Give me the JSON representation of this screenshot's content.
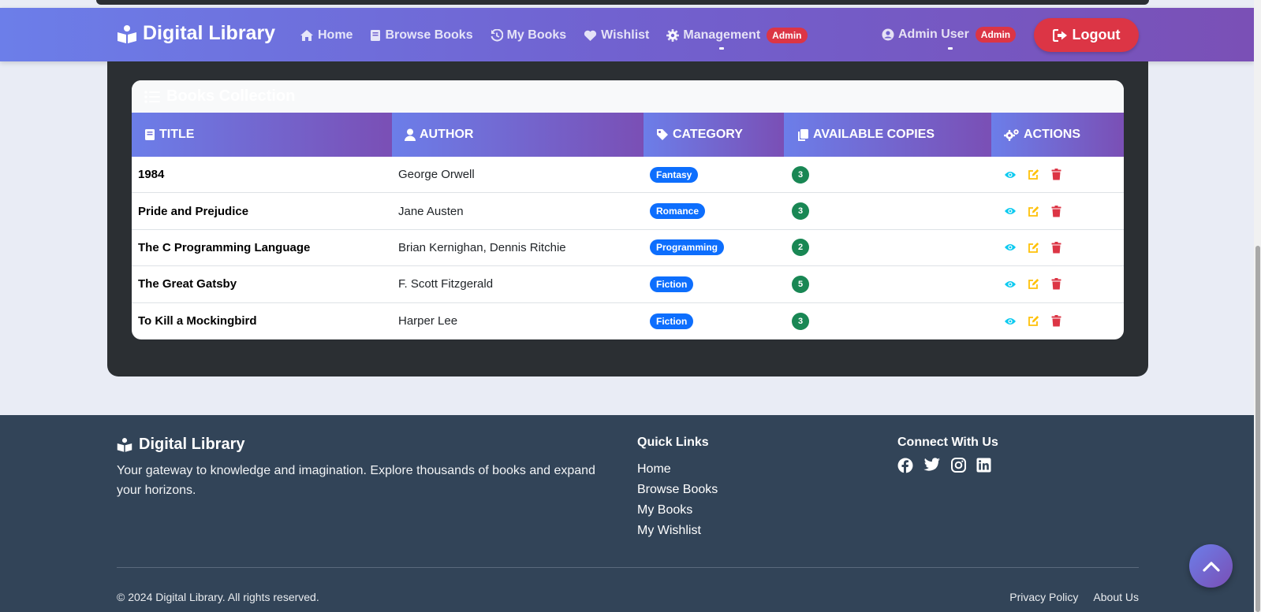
{
  "brand": {
    "name": "Digital Library",
    "icon": "reader-icon"
  },
  "nav": {
    "home": "Home",
    "browse": "Browse Books",
    "mybooks": "My Books",
    "wishlist": "Wishlist",
    "management": "Management",
    "management_badge": "Admin"
  },
  "user": {
    "name": "Admin User",
    "badge": "Admin",
    "logout": "Logout"
  },
  "table": {
    "header": "Books Collection",
    "columns": [
      "TITLE",
      "AUTHOR",
      "CATEGORY",
      "AVAILABLE COPIES",
      "ACTIONS"
    ],
    "rows": [
      {
        "title": "1984",
        "author": "George Orwell",
        "category": "Fantasy",
        "copies": "3"
      },
      {
        "title": "Pride and Prejudice",
        "author": "Jane Austen",
        "category": "Romance",
        "copies": "3"
      },
      {
        "title": "The C Programming Language",
        "author": "Brian Kernighan, Dennis Ritchie",
        "category": "Programming",
        "copies": "2"
      },
      {
        "title": "The Great Gatsby",
        "author": "F. Scott Fitzgerald",
        "category": "Fiction",
        "copies": "5"
      },
      {
        "title": "To Kill a Mockingbird",
        "author": "Harper Lee",
        "category": "Fiction",
        "copies": "3"
      }
    ],
    "action_icons": [
      "eye-icon",
      "edit-icon",
      "trash-icon"
    ]
  },
  "footer": {
    "brand": "Digital Library",
    "description": "Your gateway to knowledge and imagination. Explore thousands of books and expand your horizons.",
    "quick_links_title": "Quick Links",
    "quick_links": [
      "Home",
      "Browse Books",
      "My Books",
      "My Wishlist"
    ],
    "connect_title": "Connect With Us",
    "social": [
      "facebook-icon",
      "twitter-icon",
      "instagram-icon",
      "linkedin-icon"
    ],
    "copyright": "© 2024 Digital Library. All rights reserved.",
    "privacy": "Privacy Policy",
    "about": "About Us"
  },
  "colors": {
    "accent_start": "#6c7ee9",
    "accent_end": "#7a4fb5",
    "danger": "#dc3545",
    "primary": "#0d6efd",
    "success": "#198754",
    "footer_bg": "#324458"
  }
}
